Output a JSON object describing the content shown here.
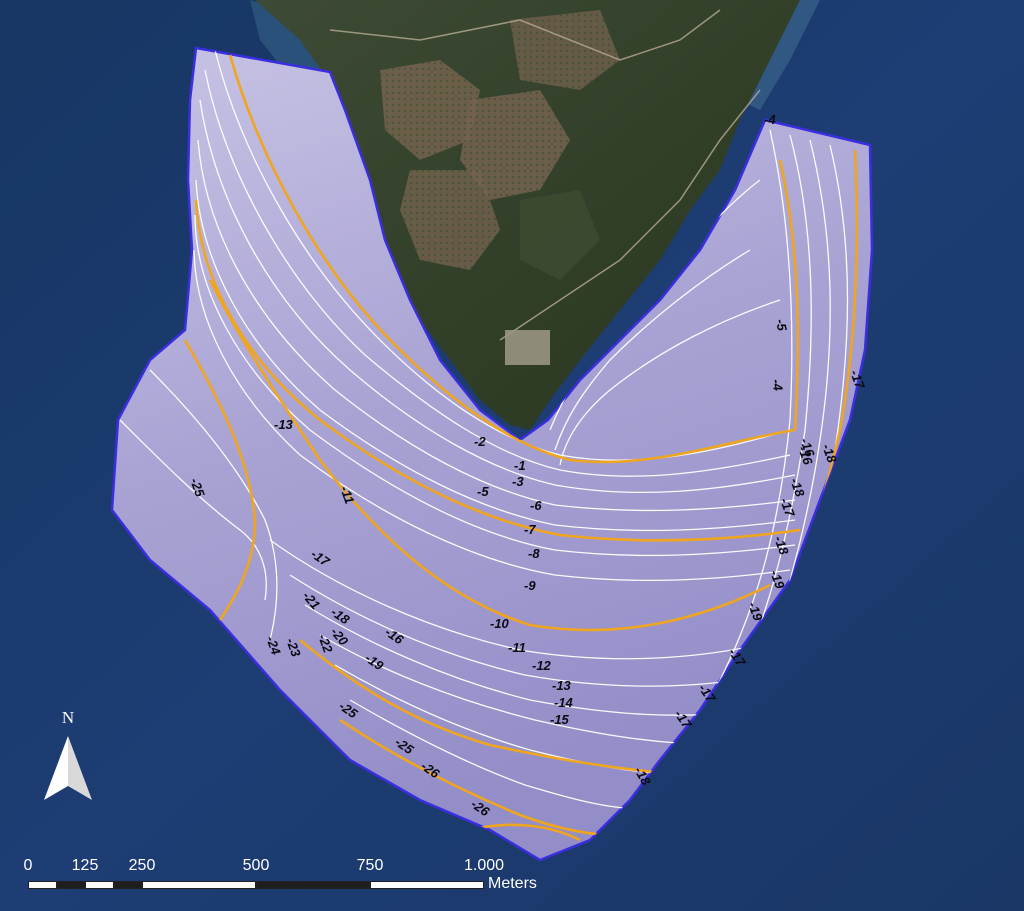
{
  "map": {
    "colors": {
      "sea": "#1b3a6e",
      "land_dark": "#2b3a28",
      "land_field": "#6b5a47",
      "bathymetry_fill": "#a9a3d0",
      "contour_minor": "#ffffff",
      "contour_major": "#f0a51e",
      "label_text": "#0b0b14"
    },
    "contour_labels": [
      {
        "id": "lbl-13",
        "text": "-13"
      },
      {
        "id": "lbl-25a",
        "text": "-25"
      },
      {
        "id": "lbl-11a",
        "text": "-11"
      },
      {
        "id": "lbl-2",
        "text": "-2"
      },
      {
        "id": "lbl-1",
        "text": "-1"
      },
      {
        "id": "lbl-3",
        "text": "-3"
      },
      {
        "id": "lbl-5a",
        "text": "-5"
      },
      {
        "id": "lbl-6",
        "text": "-6"
      },
      {
        "id": "lbl-7",
        "text": "-7"
      },
      {
        "id": "lbl-8",
        "text": "-8"
      },
      {
        "id": "lbl-9",
        "text": "-9"
      },
      {
        "id": "lbl-10",
        "text": "-10"
      },
      {
        "id": "lbl-11b",
        "text": "-11"
      },
      {
        "id": "lbl-12",
        "text": "-12"
      },
      {
        "id": "lbl-13b",
        "text": "-13"
      },
      {
        "id": "lbl-14",
        "text": "-14"
      },
      {
        "id": "lbl-15",
        "text": "-15"
      },
      {
        "id": "lbl-16a",
        "text": "-16"
      },
      {
        "id": "lbl-17a",
        "text": "-17"
      },
      {
        "id": "lbl-18a",
        "text": "-18"
      },
      {
        "id": "lbl-19a",
        "text": "-19"
      },
      {
        "id": "lbl-20",
        "text": "-20"
      },
      {
        "id": "lbl-21",
        "text": "-21"
      },
      {
        "id": "lbl-22",
        "text": "-22"
      },
      {
        "id": "lbl-23",
        "text": "-23"
      },
      {
        "id": "lbl-24",
        "text": "-24"
      },
      {
        "id": "lbl-25b",
        "text": "-25"
      },
      {
        "id": "lbl-25c",
        "text": "-25"
      },
      {
        "id": "lbl-26",
        "text": "-26"
      },
      {
        "id": "lbl-26b",
        "text": "-26"
      },
      {
        "id": "lbl-4a",
        "text": "-4"
      },
      {
        "id": "lbl-5b",
        "text": "-5"
      },
      {
        "id": "lbl-4b",
        "text": "-4"
      },
      {
        "id": "lbl-16b",
        "text": "-16"
      },
      {
        "id": "lbl-17b",
        "text": "-17"
      },
      {
        "id": "lbl-18b",
        "text": "-18"
      },
      {
        "id": "lbl-17c",
        "text": "-17"
      },
      {
        "id": "lbl-18c",
        "text": "-18"
      },
      {
        "id": "lbl-16c",
        "text": "-16"
      },
      {
        "id": "lbl-18d",
        "text": "-18"
      },
      {
        "id": "lbl-19b",
        "text": "-19"
      },
      {
        "id": "lbl-19c",
        "text": "-19"
      },
      {
        "id": "lbl-17d",
        "text": "-17"
      },
      {
        "id": "lbl-17e",
        "text": "-17"
      },
      {
        "id": "lbl-17f",
        "text": "-17"
      },
      {
        "id": "lbl-18e",
        "text": "-18"
      }
    ],
    "north_arrow": {
      "letter": "N"
    },
    "scale_bar": {
      "ticks": [
        "0",
        "125",
        "250",
        "500",
        "750",
        "1.000"
      ],
      "unit": "Meters"
    }
  }
}
